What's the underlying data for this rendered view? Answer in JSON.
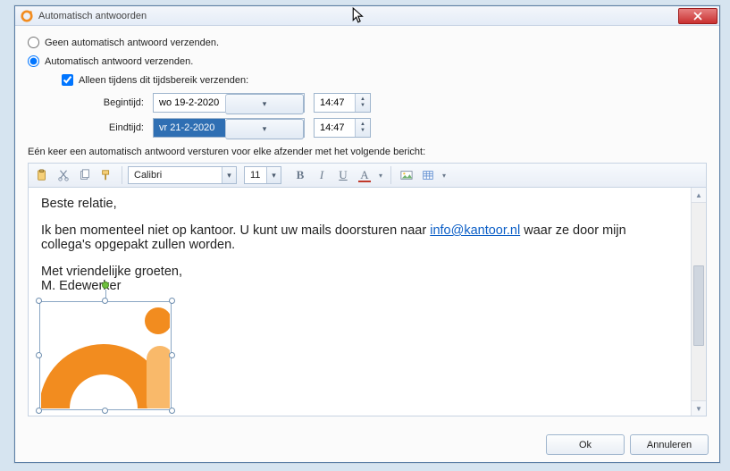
{
  "window": {
    "title": "Automatisch antwoorden"
  },
  "radios": {
    "no_auto": "Geen automatisch antwoord verzenden.",
    "auto": "Automatisch antwoord verzenden."
  },
  "checkbox": {
    "range_only": "Alleen tijdens dit tijdsbereik verzenden:"
  },
  "times": {
    "start_label": "Begintijd:",
    "end_label": "Eindtijd:",
    "start_date": "wo 19-2-2020",
    "start_time": "14:47",
    "end_date": "vr 21-2-2020",
    "end_time": "14:47"
  },
  "instruction": "Eén keer een automatisch antwoord versturen voor elke afzender met het volgende bericht:",
  "toolbar": {
    "font_name": "Calibri",
    "font_size": "11",
    "bold": "B",
    "italic": "I",
    "underline": "U",
    "fontcolor": "A"
  },
  "message": {
    "greeting": "Beste relatie,",
    "body_pre": "Ik ben momenteel niet op kantoor. U kunt uw mails doorsturen naar ",
    "link_text": "info@kantoor.nl",
    "body_post": " waar ze door mijn collega's opgepakt zullen worden.",
    "signoff": "Met vriendelijke groeten,",
    "name": "M. Edewerker"
  },
  "buttons": {
    "ok": "Ok",
    "cancel": "Annuleren"
  },
  "colors": {
    "accent": "#f28c1f",
    "link": "#0b5ec6",
    "selection": "#2f6fb3"
  }
}
